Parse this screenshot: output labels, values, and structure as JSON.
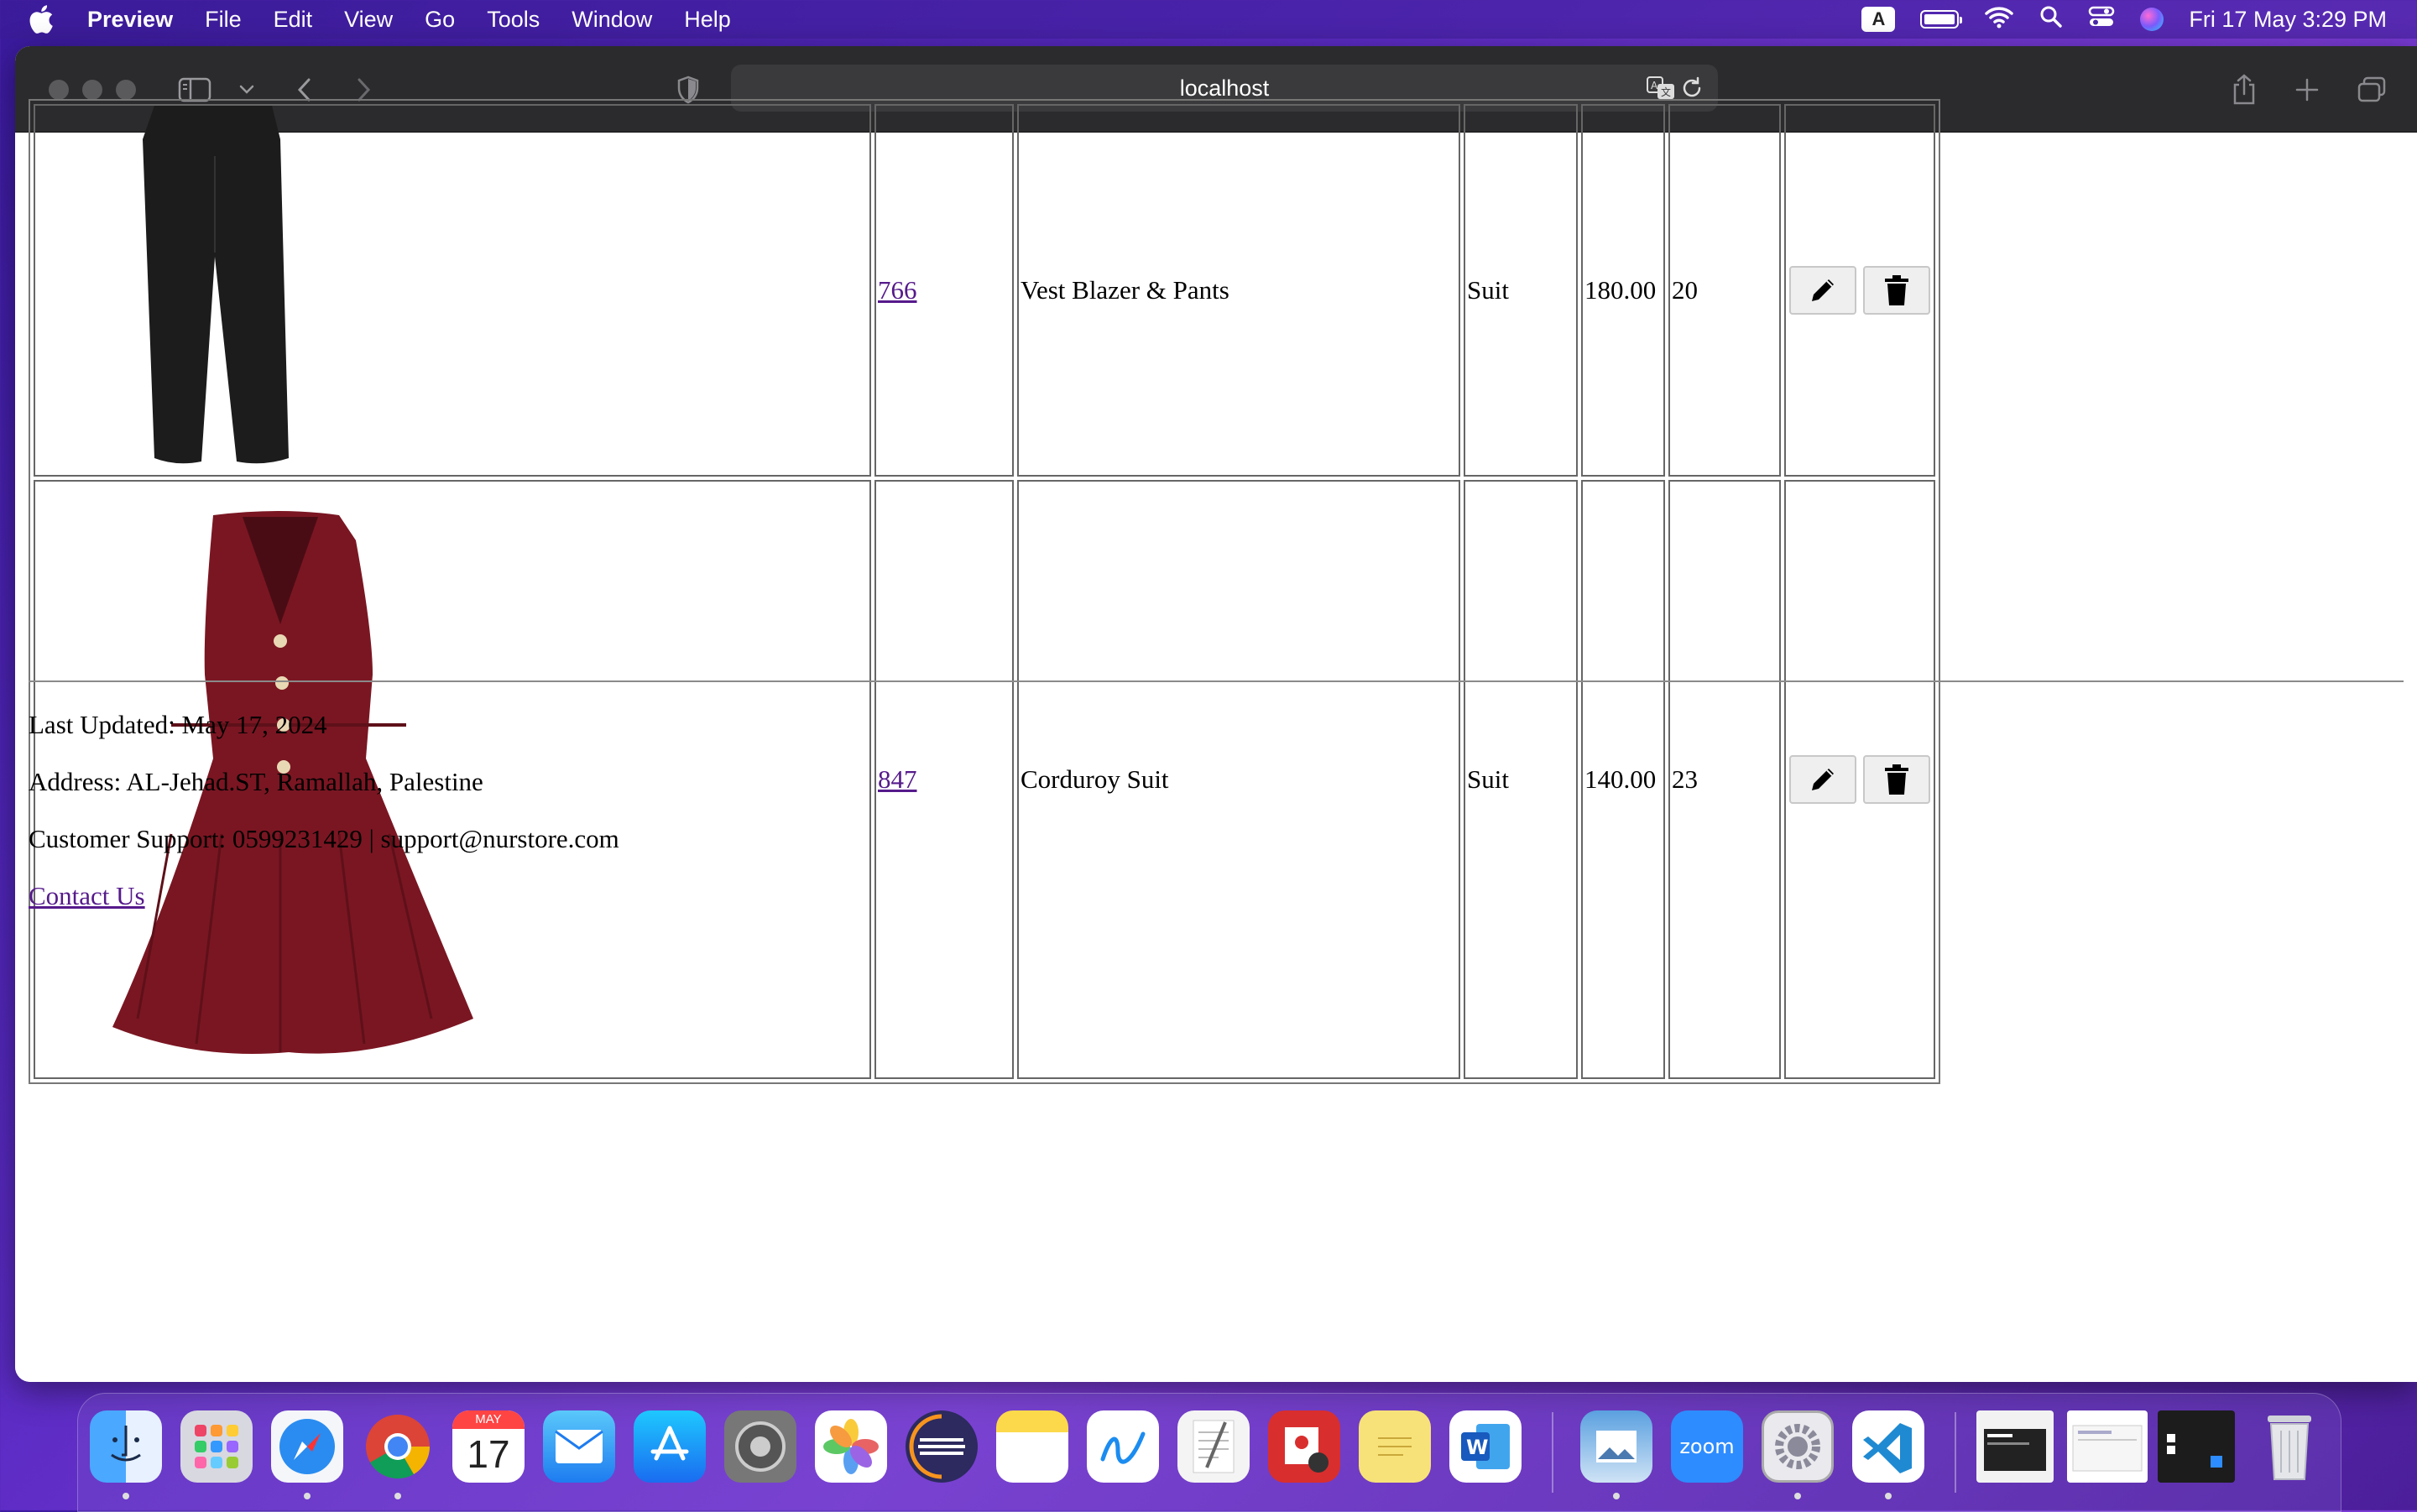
{
  "menubar": {
    "app_name": "Preview",
    "items": [
      "File",
      "Edit",
      "View",
      "Go",
      "Tools",
      "Window",
      "Help"
    ],
    "input_source": "A",
    "clock": "Fri 17 May  3:29 PM"
  },
  "browser": {
    "url": "localhost"
  },
  "products": [
    {
      "id": "766",
      "name": "Vest Blazer & Pants",
      "category": "Suit",
      "price": "180.00",
      "quantity": "20",
      "image": "black-pants-image"
    },
    {
      "id": "847",
      "name": "Corduroy Suit",
      "category": "Suit",
      "price": "140.00",
      "quantity": "23",
      "image": "burgundy-vest-dress-image"
    }
  ],
  "footer": {
    "last_updated": "Last Updated: May 17, 2024",
    "address": "Address: AL-Jehad.ST, Ramallah, Palestine",
    "support": "Customer Support: 0599231429 | support@nurstore.com",
    "contact_link": "Contact Us"
  },
  "dock": {
    "calendar_month": "MAY",
    "calendar_day": "17",
    "zoom_label": "zoom",
    "apps": [
      "finder-icon",
      "launchpad-icon",
      "safari-icon",
      "chrome-icon",
      "calendar-icon",
      "mail-icon",
      "app-store-icon",
      "system-settings-icon",
      "photos-icon",
      "eclipse-icon",
      "notes-icon",
      "freeform-icon",
      "textedit-icon",
      "photo-booth-icon",
      "stickies-icon",
      "word-icon",
      "preview-icon",
      "zoom-icon",
      "settings-gear-icon",
      "vscode-icon"
    ]
  },
  "colors": {
    "link": "#551a8b",
    "toolbar": "#2b2b2d",
    "burgundy": "#7a1622"
  }
}
